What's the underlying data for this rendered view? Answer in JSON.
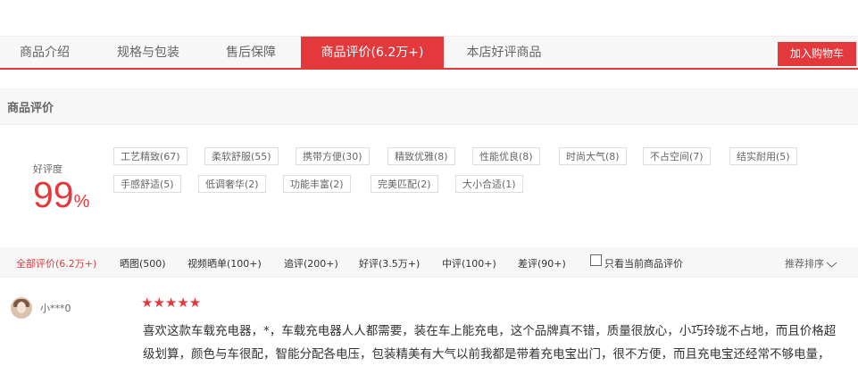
{
  "tabs": [
    {
      "label": "商品介绍"
    },
    {
      "label": "规格与包装"
    },
    {
      "label": "售后保障"
    },
    {
      "label": "商品评价(6.2万+)"
    },
    {
      "label": "本店好评商品"
    }
  ],
  "cart_button": "加入购物车",
  "section_title": "商品评价",
  "rating": {
    "label": "好评度",
    "value": "99",
    "unit": "%"
  },
  "tags_row1": [
    "工艺精致(67)",
    "柔软舒服(55)",
    "携带方便(30)",
    "精致优雅(8)",
    "性能优良(8)",
    "时尚大气(8)",
    "不占空间(7)",
    "结实耐用(5)"
  ],
  "tags_row2": [
    "手感舒适(5)",
    "低调奢华(2)",
    "功能丰富(2)",
    "完美匹配(2)",
    "大小合适(1)"
  ],
  "filters": [
    "全部评价(6.2万+)",
    "晒图(500)",
    "视频晒单(100+)",
    "追评(200+)",
    "好评(3.5万+)",
    "中评(100+)",
    "差评(90+)"
  ],
  "only_current_label": "只看当前商品评价",
  "sort_label": "推荐排序",
  "colors": {
    "accent": "#e4393c"
  },
  "review": {
    "username": "小***0",
    "stars": "★★★★★",
    "line1": "喜欢这款车载充电器，*，车载充电器人人都需要，装在车上能充电，这个品牌真不错，质量很放心，小巧玲珑不占地，而且价格超",
    "line2": "级划算，颜色与车很配，智能分配各电压，包装精美有大气以前我都是带着充电宝出门，很不方便，而且充电宝还经常不够电量，"
  }
}
